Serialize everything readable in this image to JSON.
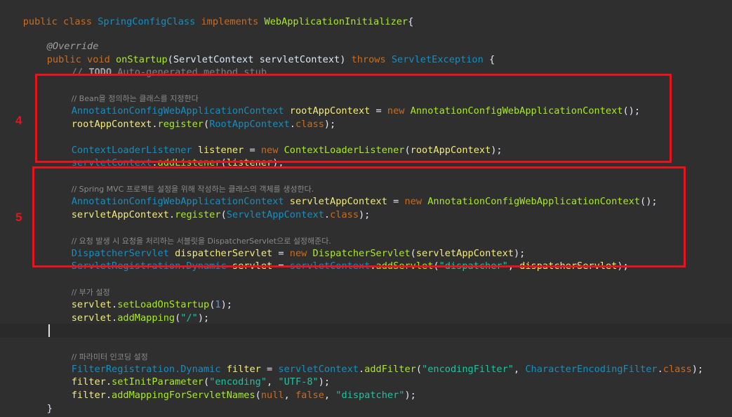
{
  "code": {
    "class_decl": {
      "kw_public": "public",
      "kw_class": "class",
      "class_name": "SpringConfigClass",
      "kw_implements": "implements",
      "iface": "WebApplicationInitializer",
      "brace": "{"
    },
    "override": "@Override",
    "method_decl": {
      "kw_public": "public",
      "kw_void": "void",
      "name": "onStartup",
      "param_type": "ServletContext",
      "param_name": "servletContext",
      "kw_throws": "throws",
      "exc": "ServletException",
      "brace": "{"
    },
    "todo_comment": {
      "slashes": "// ",
      "todo": "TODO",
      "rest": " Auto-generated method stub"
    },
    "block4": {
      "comment": "// Bean을 정의하는 클래스를 지정한다",
      "l1_type": "AnnotationConfigWebApplicationContext",
      "l1_var": "rootAppContext",
      "l1_new": "new",
      "l1_ctor": "AnnotationConfigWebApplicationContext",
      "l2_obj": "rootAppContext",
      "l2_method": "register",
      "l2_arg": "RootAppContext",
      "l2_class": "class",
      "l3_type": "ContextLoaderListener",
      "l3_var": "listener",
      "l3_new": "new",
      "l3_ctor": "ContextLoaderListener",
      "l3_arg": "rootAppContext",
      "l4_obj": "servletContext",
      "l4_method": "addListener",
      "l4_arg": "listener"
    },
    "block5": {
      "comment1": "// Spring MVC 프로젝트 설정을 위해 작성하는 클래스의 객체를 생성한다.",
      "l1_type": "AnnotationConfigWebApplicationContext",
      "l1_var": "servletAppContext",
      "l1_new": "new",
      "l1_ctor": "AnnotationConfigWebApplicationContext",
      "l2_obj": "servletAppContext",
      "l2_method": "register",
      "l2_arg": "ServletAppContext",
      "l2_class": "class",
      "comment2": "// 요청 발생 시 요청을 처리하는 서블릿을 DispatcherServlet으로 설정해준다.",
      "l3_type": "DispatcherServlet",
      "l3_var": "dispatcherServlet",
      "l3_new": "new",
      "l3_ctor": "DispatcherServlet",
      "l3_arg": "servletAppContext",
      "l4_type": "ServletRegistration.Dynamic",
      "l4_var": "servlet",
      "l4_obj": "servletContext",
      "l4_method": "addServlet",
      "l4_str": "\"dispatcher\"",
      "l4_arg": "dispatcherServlet"
    },
    "extra": {
      "comment": "// 부가 설정",
      "l1_obj": "servlet",
      "l1_method": "setLoadOnStartup",
      "l1_num": "1",
      "l2_obj": "servlet",
      "l2_method": "addMapping",
      "l2_str": "\"/\""
    },
    "filter": {
      "comment": "// 파라미터 인코딩 설정",
      "l1_type": "FilterRegistration.Dynamic",
      "l1_var": "filter",
      "l1_obj": "servletContext",
      "l1_method": "addFilter",
      "l1_str": "\"encodingFilter\"",
      "l1_cls": "CharacterEncodingFilter",
      "l1_kw": "class",
      "l2_obj": "filter",
      "l2_method": "setInitParameter",
      "l2_str1": "\"encoding\"",
      "l2_str2": "\"UTF-8\"",
      "l3_obj": "filter",
      "l3_method": "addMappingForServletNames",
      "l3_null": "null",
      "l3_false": "false",
      "l3_str": "\"dispatcher\""
    },
    "close_method": "}",
    "close_class": "}"
  },
  "annotations": {
    "marker4": "4",
    "marker5": "5",
    "box_color": "#e8141d"
  }
}
